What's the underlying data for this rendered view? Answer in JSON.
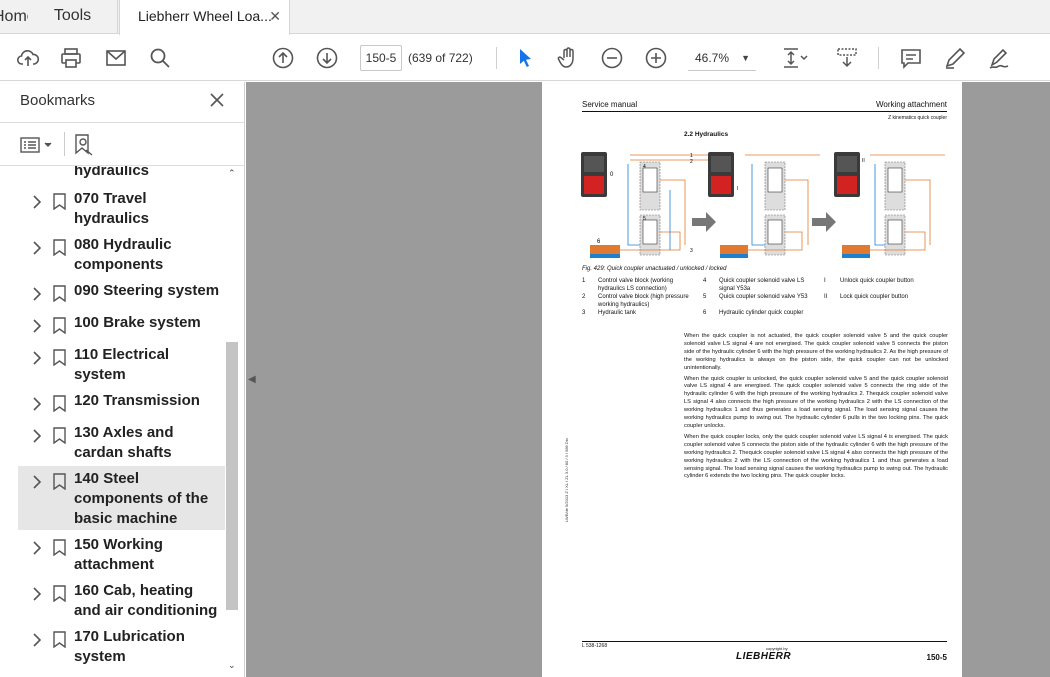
{
  "tabs": {
    "home": "Home",
    "tools": "Tools",
    "document": "Liebherr Wheel Loa...",
    "close": "✕"
  },
  "toolbar": {
    "icons": [
      "upload-cloud-icon",
      "print-icon",
      "email-icon",
      "search-icon",
      "prev-page-icon",
      "next-page-icon",
      "select-cursor-icon",
      "hand-icon",
      "zoom-out-icon",
      "zoom-in-icon",
      "fit-page-icon",
      "scroll-mode-icon",
      "comment-icon",
      "highlight-pen-icon",
      "sign-icon"
    ],
    "page_value": "150-5",
    "page_count": "(639 of 722)",
    "zoom_value": "46.7%"
  },
  "sidebar": {
    "title": "Bookmarks",
    "items": [
      {
        "label": "hydraulics"
      },
      {
        "label": "070 Travel\nhydraulics"
      },
      {
        "label": "080 Hydraulic\ncomponents"
      },
      {
        "label": "090 Steering system"
      },
      {
        "label": "100 Brake system"
      },
      {
        "label": "110 Electrical\nsystem"
      },
      {
        "label": "120 Transmission"
      },
      {
        "label": "130 Axles and\ncardan shafts"
      },
      {
        "label": "140 Steel\ncomponents of the\nbasic machine"
      },
      {
        "label": "150 Working\nattachment"
      },
      {
        "label": "160 Cab, heating\nand air conditioning"
      },
      {
        "label": "170 Lubrication\nsystem"
      }
    ]
  },
  "page": {
    "header_left": "Service manual",
    "header_right": "Working attachment",
    "header_sub": "Z kinematics quick coupler",
    "section_title": "2.2 Hydraulics",
    "figure_caption": "Fig. 429: Quick coupler unactuated / unlocked / locked",
    "legend": [
      {
        "num": "1",
        "text": "Control valve block (working hydraulics LS connection)"
      },
      {
        "num": "2",
        "text": "Control valve block (high pressure working hydraulics)"
      },
      {
        "num": "3",
        "text": "Hydraulic tank"
      },
      {
        "num": "4",
        "text": "Quick coupler solenoid valve LS signal Y53a"
      },
      {
        "num": "5",
        "text": "Quick coupler solenoid valve Y53"
      },
      {
        "num": "6",
        "text": "Hydraulic cylinder quick coupler"
      },
      {
        "num": "I",
        "text": "Unlock quick coupler button"
      },
      {
        "num": "II",
        "text": "Lock quick coupler button"
      }
    ],
    "paragraphs": [
      "When the quick coupler is not actuated, the quick coupler solenoid valve 5 and the quick coupler solenoid valve LS signal 4 are not energised. The quick coupler solenoid valve 5 connects the piston side of the hydraulic cylinder 6 with the high pressure of the working hydraulics 2. As the high pressure of the working hydraulics is always on the piston side, the quick coupler can not be unlocked unintentionally.",
      "When the quick coupler is unlocked, the quick coupler solenoid valve 5 and the quick coupler solenoid valve LS signal 4 are energised. The quick coupler solenoid valve 5 connects the ring side of the hydraulic cylinder 6 with the high pressure of the working hydraulics 2. Thequick coupler solenoid valve LS signal 4 also connects the high pressure of the working hydraulics 2 with the LS connection of the working hydraulics 1 and thus generates a load sensing signal. The load sensing signal causes the working hydraulics pump to swing out. The hydraulic cylinder 6 pulls in the two locking pins. The quick coupler unlocks.",
      "When the quick coupler locks, only the quick coupler solenoid valve LS signal 4 is energised. The quick coupler solenoid valve 5 connects the piston side of the hydraulic cylinder 6 with the high pressure of the working hydraulics 2. Thequick coupler solenoid valve LS signal 4 also connects the high pressure of the working hydraulics 2 with the LS connection of the working hydraulics 1 and thus generates a load sensing signal. The load sensing signal causes the working hydraulics pump to swing out. The hydraulic cylinder 6 extends the two locking pins. The quick coupler locks."
    ],
    "side_text": "LWE/de 5/2013 Z / XL / ZL 3.0 / 80 / 3 / 586 Dio",
    "footer_left": "L 538-1268",
    "footer_copyright": "copyright by",
    "footer_logo": "LIEBHERR",
    "footer_page": "150-5"
  }
}
